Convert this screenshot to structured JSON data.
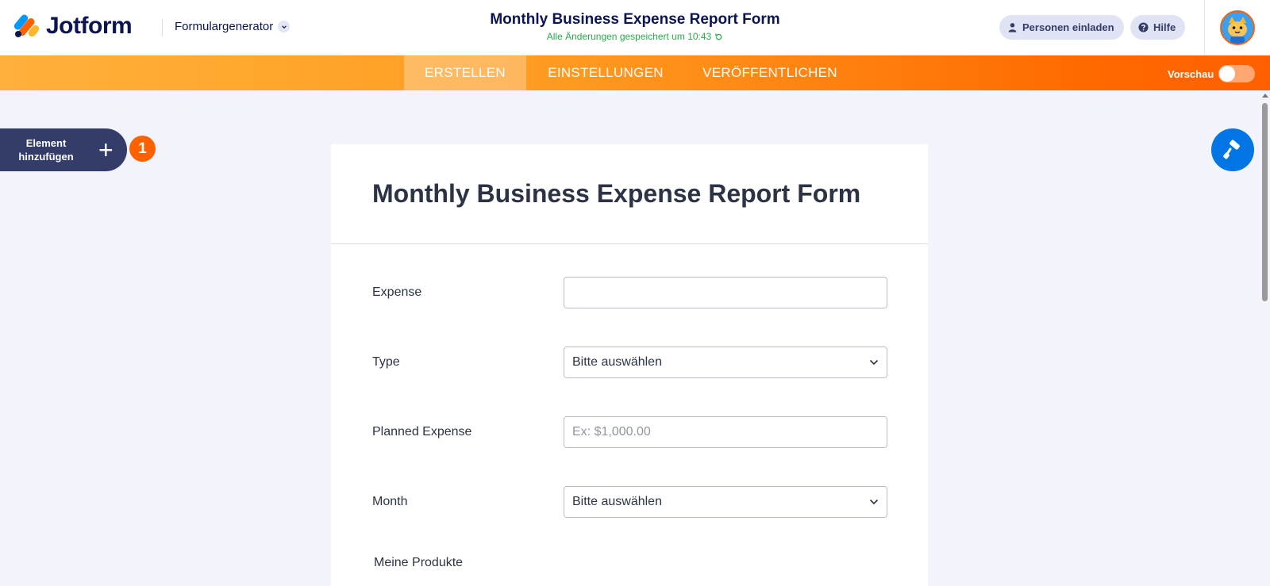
{
  "header": {
    "logo_text": "Jotform",
    "builder_label": "Formulargenerator",
    "form_title": "Monthly Business Expense Report Form",
    "save_status": "Alle Änderungen gespeichert um 10:43",
    "invite_label": "Personen einladen",
    "help_label": "Hilfe",
    "icons": {
      "invite": "person-icon",
      "help": "question-circle-icon",
      "save": "refresh-icon",
      "dropdown": "chevron-down-icon"
    }
  },
  "nav": {
    "tabs": [
      {
        "label": "ERSTELLEN",
        "active": true
      },
      {
        "label": "EINSTELLUNGEN",
        "active": false
      },
      {
        "label": "VERÖFFENTLICHEN",
        "active": false
      }
    ],
    "preview_label": "Vorschau",
    "preview_on": false
  },
  "sidebar": {
    "add_element_label": "Element hinzufügen",
    "plus_symbol": "+",
    "badge_count": "1"
  },
  "form": {
    "title": "Monthly Business Expense Report Form",
    "fields": [
      {
        "label": "Expense",
        "value": "",
        "placeholder": ""
      },
      {
        "label": "Type",
        "value": "Bitte auswählen"
      },
      {
        "label": "Planned Expense",
        "value": "",
        "placeholder": "Ex: $1,000.00"
      },
      {
        "label": "Month",
        "value": "Bitte auswählen"
      }
    ],
    "products_label": "Meine Produkte"
  },
  "colors": {
    "brand_navy": "#0a1551",
    "accent_orange": "#ff6100",
    "save_green": "#2bab4a",
    "designer_blue": "#0075e3"
  }
}
